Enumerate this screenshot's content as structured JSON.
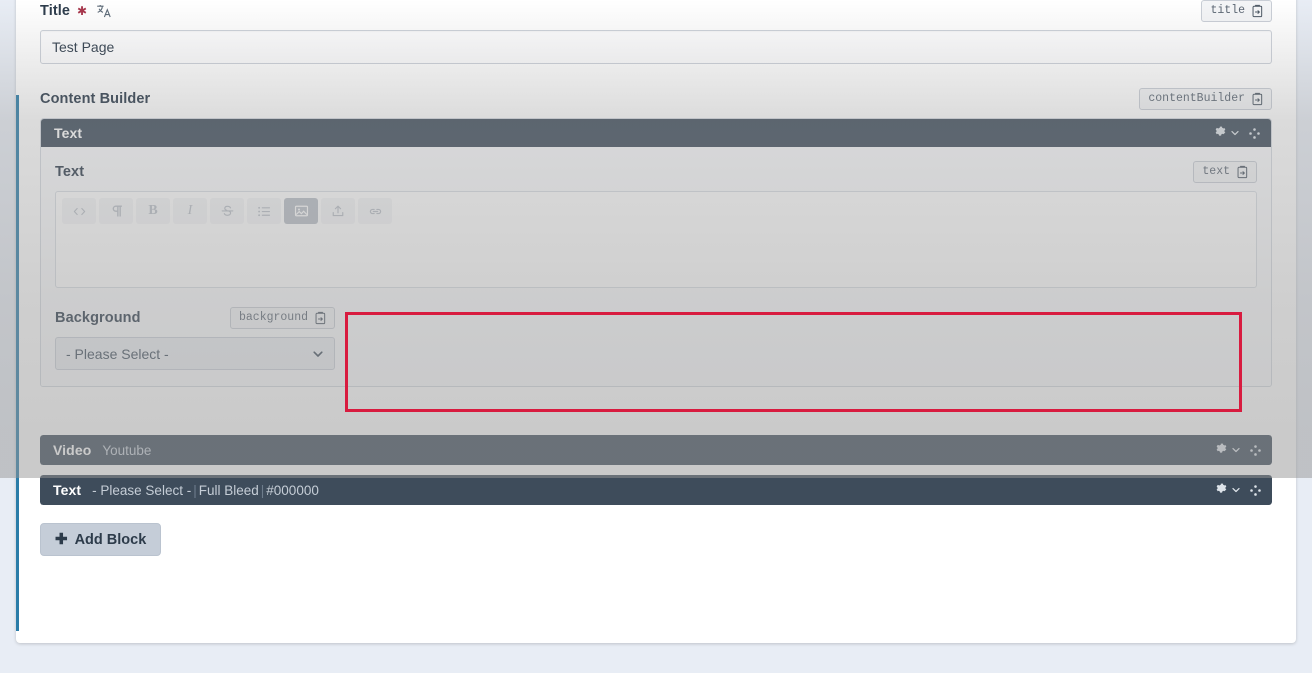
{
  "form": {
    "title_field": {
      "label": "Title",
      "required_marker": "✱",
      "translate_icon": "translate-icon",
      "key_badge": "title",
      "value": "Test Page"
    },
    "content_builder": {
      "label": "Content Builder",
      "key_badge": "contentBuilder",
      "add_block_label": "Add Block",
      "add_block_plus": "✚"
    }
  },
  "blocks": [
    {
      "type": "Text",
      "summary": "",
      "state": "expanded",
      "key_badge": "text",
      "field_label": "Text",
      "toolbar": [
        {
          "name": "code-icon",
          "glyph": "<>",
          "active": false
        },
        {
          "name": "paragraph-icon",
          "glyph": "¶",
          "active": false
        },
        {
          "name": "bold-icon",
          "glyph": "B",
          "active": false
        },
        {
          "name": "italic-icon",
          "glyph": "I",
          "active": false
        },
        {
          "name": "strikethrough-icon",
          "glyph": "S",
          "active": false
        },
        {
          "name": "unordered-list-icon",
          "glyph": "list",
          "active": false
        },
        {
          "name": "image-icon",
          "glyph": "image",
          "active": true
        },
        {
          "name": "upload-icon",
          "glyph": "upload",
          "active": false
        },
        {
          "name": "link-icon",
          "glyph": "link",
          "active": false
        }
      ],
      "editor_value": "",
      "background": {
        "label": "Background",
        "key_badge": "background",
        "selected": "- Please Select -"
      }
    },
    {
      "type": "Video",
      "summary": "Youtube",
      "state": "collapsed"
    },
    {
      "type": "Text",
      "summary_parts": [
        "- Please Select -",
        "Full Bleed",
        "#000000"
      ],
      "summary": "- Please Select - | Full Bleed | #000000",
      "state": "collapsed"
    }
  ],
  "block_tools": {
    "gear": "gear-icon",
    "chevron": "chevron-down-icon",
    "move": "move-icon"
  },
  "annotation": {
    "highlight_color": "#d81b3f",
    "shape": "rectangle"
  },
  "colors": {
    "block_header": "#3e4c5b",
    "accent_rail": "#2a7ca8",
    "page_bg": "#e8edf5",
    "required": "#a7344a"
  }
}
